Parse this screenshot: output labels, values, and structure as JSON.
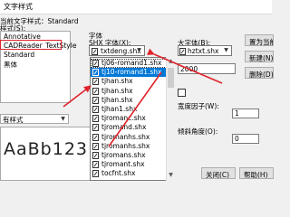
{
  "window": {
    "title": "文字样式"
  },
  "current_style": {
    "label": "当前文字样式：Standard"
  },
  "styles": {
    "label": "样式(S):",
    "items": [
      "Annotative",
      "CADReader_TextStyle",
      "Standard",
      "黑体"
    ]
  },
  "filter": {
    "value": "有样式"
  },
  "preview": {
    "text": "AaBb123"
  },
  "font": {
    "group_label": "字体",
    "shx_label": "SHX 字体(X):",
    "shx_value": "txtdeng.shx",
    "bigfont_label": "大字体(B):",
    "bigfont_value": "hztxt.shx",
    "dropdown_items": [
      "tj06-romand1.shx",
      "tj10-romand1.shx",
      "tjhan.shx",
      "tjhan.shx",
      "tjhan.shx",
      "tjhan1.shx",
      "tjromanc.shx",
      "tjromand.shx",
      "tjromanhs.shx",
      "tjromanhs.shx",
      "tjromans.shx",
      "tjromant.shx",
      "tocfnt.shx"
    ],
    "selected_index": 1
  },
  "size": {
    "height_value": "2000"
  },
  "effects": {
    "width_label": "宽度因子(W):",
    "width_value": "1",
    "oblique_label": "倾斜角度(O):",
    "oblique_value": "0"
  },
  "buttons": {
    "set_current": "置为当前(C)",
    "new": "新建(N)...",
    "delete": "删除(D)",
    "close": "关闭(C)",
    "help": "帮助(H)"
  },
  "colors": {
    "selection": "#0078d7",
    "annotation_arrow": "#e0232b"
  }
}
